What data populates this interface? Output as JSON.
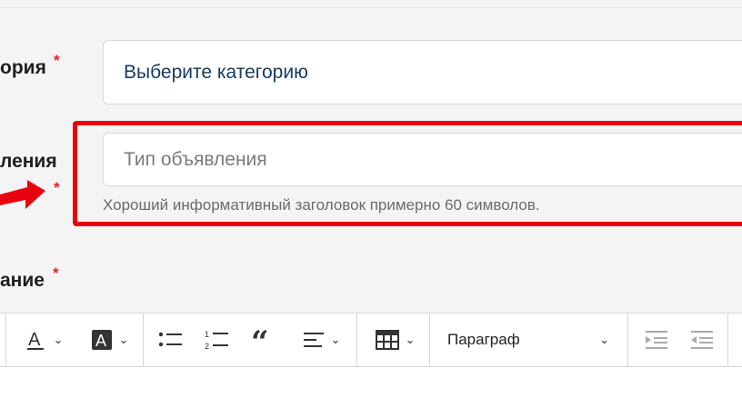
{
  "form": {
    "category": {
      "label": "ория",
      "required_mark": "*",
      "placeholder": "Выберите категорию"
    },
    "ad_type": {
      "label": "ления",
      "required_mark": "*",
      "placeholder": "Тип объявления",
      "hint": "Хороший информативный заголовок примерно 60 символов."
    },
    "description": {
      "label": "ание",
      "required_mark": "*"
    }
  },
  "toolbar": {
    "paragraph_select": "Параграф"
  },
  "colors": {
    "highlight_border": "#e8000f",
    "required": "#e8202a",
    "accent_text": "#173a5e"
  }
}
